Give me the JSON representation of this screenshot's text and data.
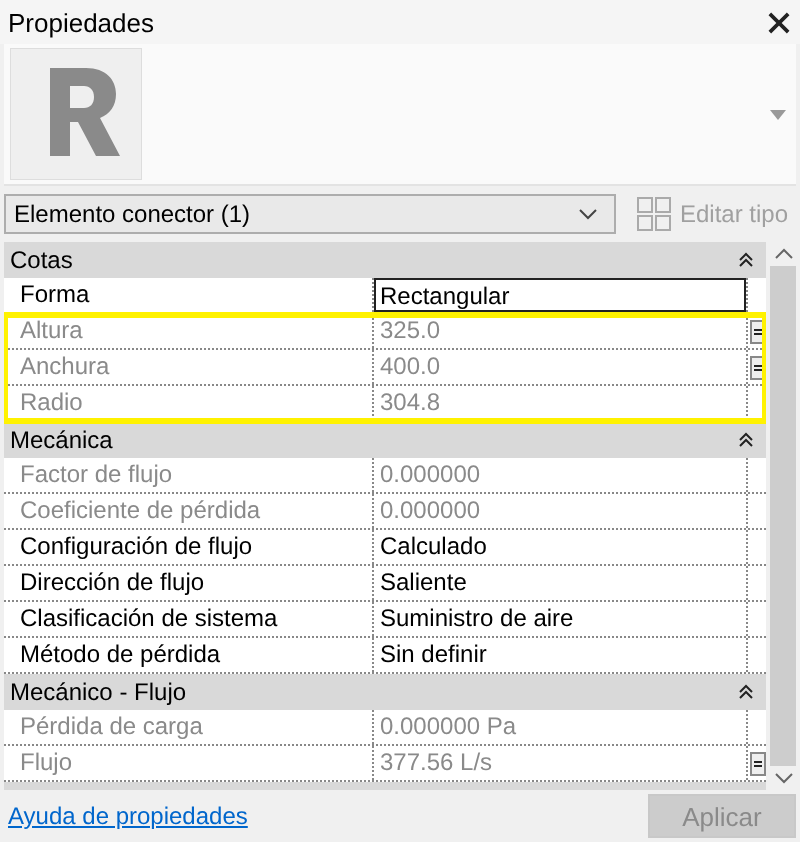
{
  "window": {
    "title": "Propiedades"
  },
  "type_selector": {
    "name": "Elemento conector (1)"
  },
  "edit_type": {
    "label": "Editar tipo",
    "disabled": true
  },
  "groups": [
    {
      "title": "Cotas",
      "expanded": true,
      "rows": [
        {
          "name": "Forma",
          "value": "Rectangular",
          "disabled": false,
          "editing": true,
          "highlighted": false,
          "param_button": false
        },
        {
          "name": "Altura",
          "value": "325.0",
          "disabled": true,
          "editing": false,
          "highlighted": true,
          "param_button": true
        },
        {
          "name": "Anchura",
          "value": "400.0",
          "disabled": true,
          "editing": false,
          "highlighted": true,
          "param_button": true
        },
        {
          "name": "Radio",
          "value": "304.8",
          "disabled": true,
          "editing": false,
          "highlighted": true,
          "param_button": false
        }
      ]
    },
    {
      "title": "Mecánica",
      "expanded": true,
      "rows": [
        {
          "name": "Factor de flujo",
          "value": "0.000000",
          "disabled": true,
          "editing": false,
          "highlighted": false,
          "param_button": false
        },
        {
          "name": "Coeficiente de pérdida",
          "value": "0.000000",
          "disabled": true,
          "editing": false,
          "highlighted": false,
          "param_button": false
        },
        {
          "name": "Configuración de flujo",
          "value": "Calculado",
          "disabled": false,
          "editing": false,
          "highlighted": false,
          "param_button": false
        },
        {
          "name": "Dirección de flujo",
          "value": "Saliente",
          "disabled": false,
          "editing": false,
          "highlighted": false,
          "param_button": false
        },
        {
          "name": "Clasificación de sistema",
          "value": "Suministro de aire",
          "disabled": false,
          "editing": false,
          "highlighted": false,
          "param_button": false
        },
        {
          "name": "Método de pérdida",
          "value": "Sin definir",
          "disabled": false,
          "editing": false,
          "highlighted": false,
          "param_button": false
        }
      ]
    },
    {
      "title": "Mecánico - Flujo",
      "expanded": true,
      "rows": [
        {
          "name": "Pérdida de carga",
          "value": "0.000000 Pa",
          "disabled": true,
          "editing": false,
          "highlighted": false,
          "param_button": false
        },
        {
          "name": "Flujo",
          "value": "377.56 L/s",
          "disabled": true,
          "editing": false,
          "highlighted": false,
          "param_button": true
        }
      ]
    }
  ],
  "help_link": "Ayuda de propiedades",
  "apply_button": {
    "label": "Aplicar",
    "disabled": true
  }
}
